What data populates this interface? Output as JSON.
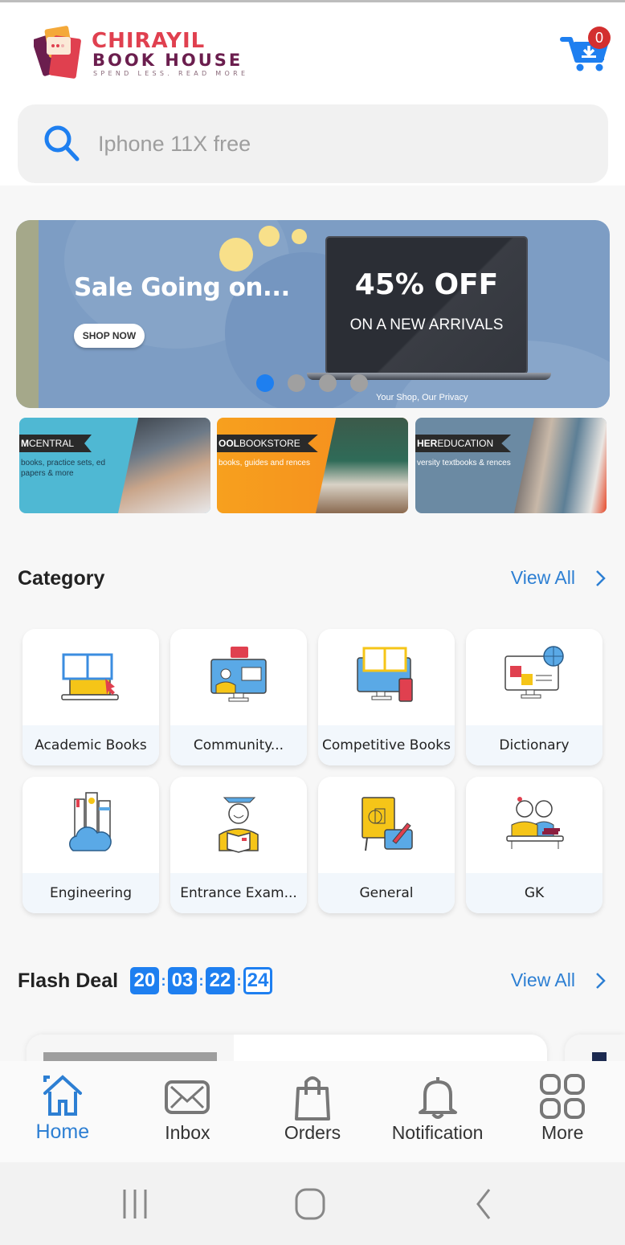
{
  "header": {
    "logo": {
      "line1": "CHIRAYIL",
      "line2": "BOOK HOUSE",
      "tagline": "SPEND LESS. READ MORE"
    },
    "cart": {
      "icon": "cart-download-icon",
      "count": "0"
    },
    "search": {
      "icon": "search-icon",
      "placeholder": "Iphone 11X free",
      "value": ""
    }
  },
  "banner": {
    "title": "Sale Going on...",
    "button": "SHOP NOW",
    "offer": "45% OFF",
    "offer_sub": "ON A NEW ARRIVALS",
    "footer": "Your Shop, Our Privacy",
    "slides_total": 4,
    "active_slide": 1,
    "colors": {
      "background": "#7d9dc4",
      "accent_dot": "#1e7ff0",
      "inactive_dot": "#a0a0a0"
    }
  },
  "promos": [
    {
      "ribbon_bold": "M",
      "ribbon_rest": "CENTRAL",
      "desc": "books, practice sets, ed papers & more",
      "bg": "#4fb8d3",
      "text_color": "#1d3b4d"
    },
    {
      "ribbon_bold": "OOL",
      "ribbon_rest": "BOOKSTORE",
      "desc": "books, guides and rences",
      "bg": "#f7931e",
      "text_color": "#ffffff"
    },
    {
      "ribbon_bold": "HER",
      "ribbon_rest": "EDUCATION",
      "desc": "versity textbooks & rences",
      "bg": "#6b8aa3",
      "text_color": "#ffffff"
    }
  ],
  "category": {
    "title": "Category",
    "view_all": "View All",
    "items": [
      {
        "label": "Academic Books",
        "icon": "laptop-book-icon"
      },
      {
        "label": "Community...",
        "icon": "video-teacher-icon"
      },
      {
        "label": "Competitive Books",
        "icon": "monitor-book-phone-icon"
      },
      {
        "label": "Dictionary",
        "icon": "monitor-globe-icon"
      },
      {
        "label": "Engineering",
        "icon": "books-cloud-icon"
      },
      {
        "label": "Entrance Exam...",
        "icon": "graduate-reading-icon"
      },
      {
        "label": "General",
        "icon": "easel-tablet-icon"
      },
      {
        "label": "GK",
        "icon": "students-desk-icon"
      }
    ]
  },
  "flash_deal": {
    "title": "Flash Deal",
    "view_all": "View All",
    "timer": {
      "days": "20",
      "hours": "03",
      "minutes": "22",
      "seconds": "24"
    }
  },
  "bottom_nav": {
    "active": "Home",
    "items": [
      {
        "label": "Home",
        "icon": "home-icon"
      },
      {
        "label": "Inbox",
        "icon": "mail-icon"
      },
      {
        "label": "Orders",
        "icon": "shopping-bag-icon"
      },
      {
        "label": "Notification",
        "icon": "bell-icon"
      },
      {
        "label": "More",
        "icon": "grid-icon"
      }
    ]
  },
  "system_nav": [
    "recent-apps-icon",
    "home-circle-icon",
    "back-icon"
  ],
  "colors": {
    "primary": "#1e7ff0",
    "link": "#2d7fd3",
    "badge": "#d32f2f",
    "logo_red": "#e0404f",
    "logo_purple": "#6b1e4e"
  }
}
